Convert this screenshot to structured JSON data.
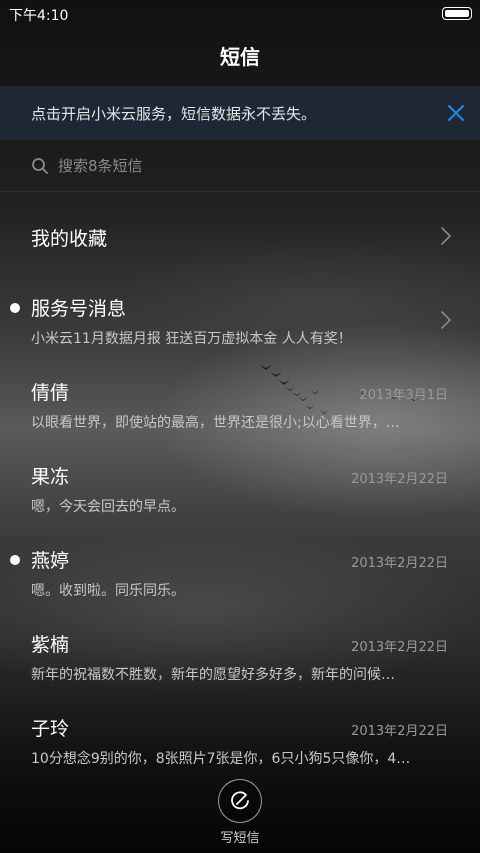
{
  "status_bar": {
    "time": "下午4:10",
    "battery_level": 1.0
  },
  "header": {
    "title": "短信"
  },
  "banner": {
    "text": "点击开启小米云服务，短信数据永不丢失。",
    "close_icon": "close-icon",
    "accent_color": "#1e88e5"
  },
  "search": {
    "placeholder": "搜索8条短信",
    "value": ""
  },
  "favorites": {
    "label": "我的收藏"
  },
  "conversations": [
    {
      "name": "服务号消息",
      "date": "",
      "preview": "小米云11月数据月报 狂送百万虚拟本金 人人有奖！",
      "unread": true
    },
    {
      "name": "倩倩",
      "date": "2013年3月1日",
      "preview": "以眼看世界，即使站的最高，世界还是很小;以心看世界，…",
      "unread": false
    },
    {
      "name": "果冻",
      "date": "2013年2月22日",
      "preview": "嗯，今天会回去的早点。",
      "unread": false
    },
    {
      "name": "燕婷",
      "date": "2013年2月22日",
      "preview": "嗯。收到啦。同乐同乐。",
      "unread": true
    },
    {
      "name": "紫楠",
      "date": "2013年2月22日",
      "preview": "新年的祝福数不胜数，新年的愿望好多好多，新年的问候…",
      "unread": false
    },
    {
      "name": "子玲",
      "date": "2013年2月22日",
      "preview": "10分想念9别的你，8张照片7张是你，6只小狗5只像你，4…",
      "unread": false
    }
  ],
  "compose": {
    "label": "写短信",
    "icon": "compose-icon"
  }
}
